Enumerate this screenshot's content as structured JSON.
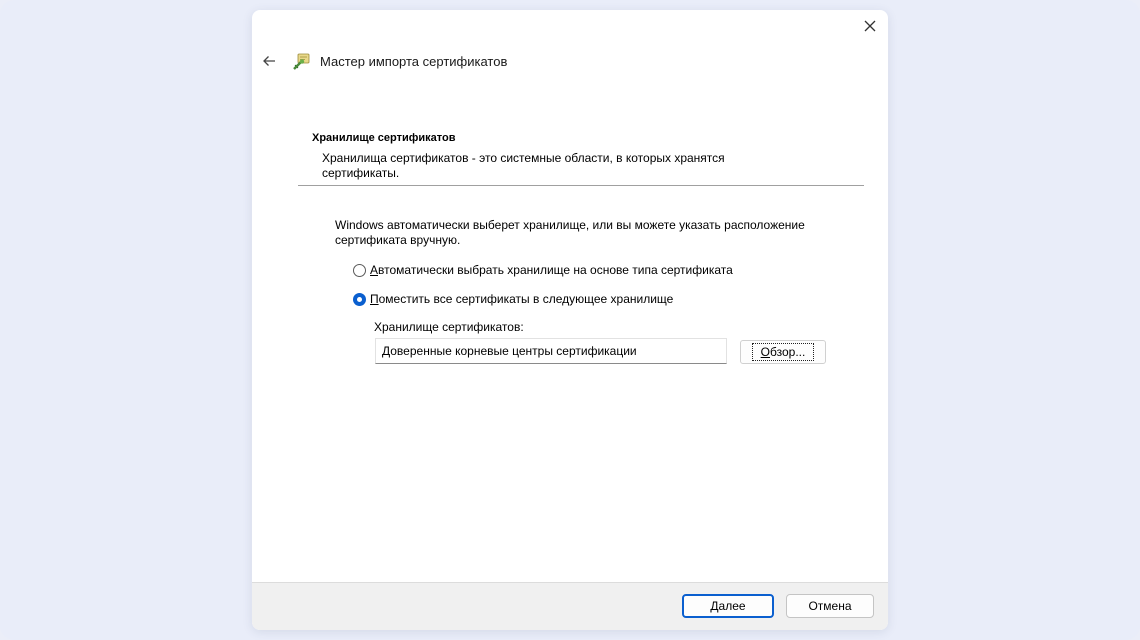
{
  "wizard": {
    "title": "Мастер импорта сертификатов",
    "icon": "certificate-wizard-icon"
  },
  "section": {
    "heading": "Хранилище сертификатов",
    "description": "Хранилища сертификатов - это системные области, в которых хранятся сертификаты."
  },
  "body": {
    "intro": "Windows автоматически выберет хранилище, или вы можете указать расположение сертификата вручную.",
    "radio_auto": {
      "first": "А",
      "rest": "втоматически выбрать хранилище на основе типа сертификата",
      "checked": false
    },
    "radio_manual": {
      "first": "П",
      "rest": "оместить все сертификаты в следующее хранилище",
      "checked": true
    },
    "store_label": "Хранилище сертификатов:",
    "store_value": "Доверенные корневые центры сертификации",
    "browse": {
      "first": "О",
      "rest": "бзор..."
    }
  },
  "footer": {
    "next": {
      "first": "Д",
      "rest": "алее"
    },
    "cancel": "Отмена"
  },
  "colors": {
    "accent": "#0a5fcf",
    "backdrop": "#e9edf9",
    "footer": "#f0f0f0"
  }
}
